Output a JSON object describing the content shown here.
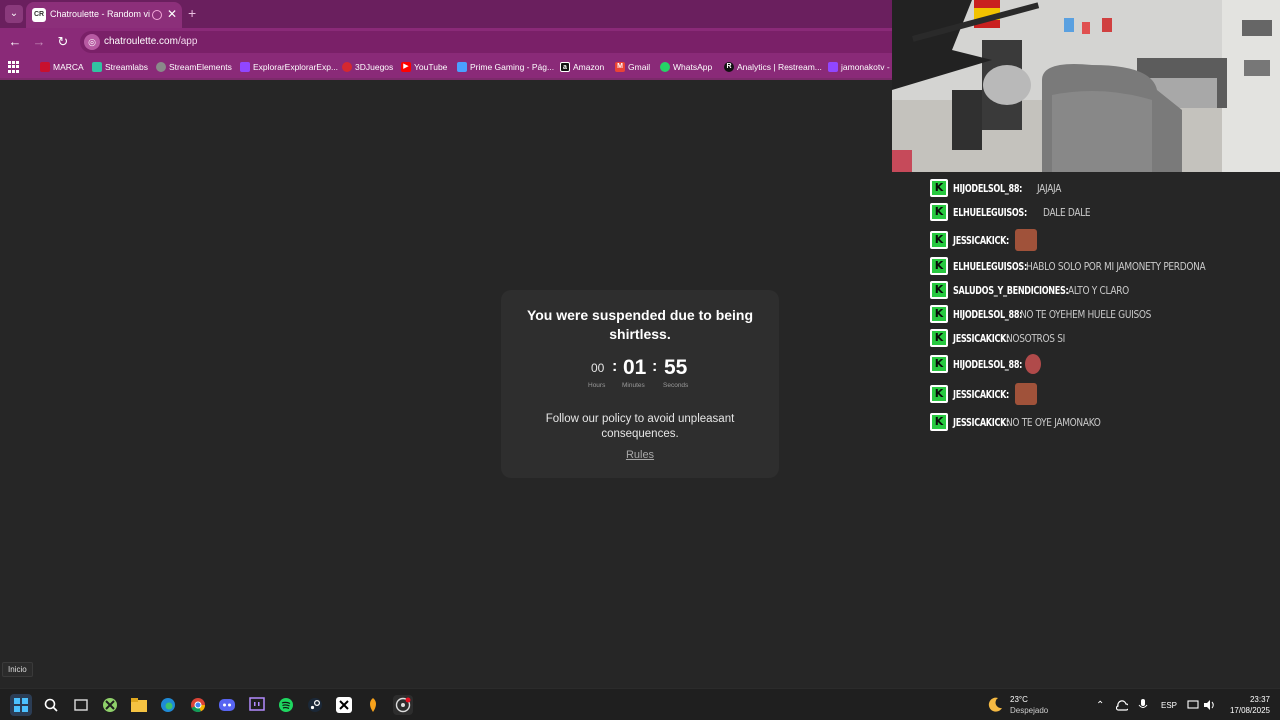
{
  "browser": {
    "tab_title": "Chatroulette - Random vid",
    "favicon": "CR",
    "url_host": "chatroulette.com",
    "url_path": "/app",
    "bookmarks": [
      {
        "label": "MARCA",
        "color": "#c8102e"
      },
      {
        "label": "Streamlabs",
        "color": "#31c3a2"
      },
      {
        "label": "StreamElements",
        "color": "#8a8a8a"
      },
      {
        "label": "ExplorarExplorarExp...",
        "color": "#9146ff"
      },
      {
        "label": "3DJuegos",
        "color": "#d6282f"
      },
      {
        "label": "YouTube",
        "color": "#ff0000"
      },
      {
        "label": "Prime Gaming - Pág...",
        "color": "#4aa0ff"
      },
      {
        "label": "Amazon",
        "color": "#111111"
      },
      {
        "label": "Gmail",
        "color": "#ea4335"
      },
      {
        "label": "WhatsApp",
        "color": "#25d366"
      },
      {
        "label": "Analytics | Restream...",
        "color": "#111111"
      },
      {
        "label": "jamonakotv - T",
        "color": "#9146ff"
      }
    ]
  },
  "suspension": {
    "heading": "You were suspended due to being shirtless.",
    "hours": "00",
    "minutes": "01",
    "seconds": "55",
    "sep": ":",
    "hours_label": "Hours",
    "minutes_label": "Minutes",
    "seconds_label": "Seconds",
    "policy": "Follow our policy to avoid unpleasant consequences.",
    "rules": "Rules"
  },
  "chat": {
    "badge": "K",
    "messages": [
      {
        "user": "HIJODELSOL_88:",
        "text": "JAJAJA",
        "emote": null
      },
      {
        "user": "ELHUELEGUISOS:",
        "text": "DALE DALE",
        "emote": null
      },
      {
        "user": "JESSICAKICK:",
        "text": "",
        "emote": "face-emote"
      },
      {
        "user": "ELHUELEGUISOS:",
        "text": "HABLO SOLO POR MI JAMONETY PERDONA",
        "emote": null
      },
      {
        "user": "SALUDOS_Y_BENDICIONES:",
        "text": "ALTO Y CLARO",
        "emote": null
      },
      {
        "user": "HIJODELSOL_88:",
        "text": "NO TE OYEHEM HUELE GUISOS",
        "emote": null
      },
      {
        "user": "JESSICAKICK:",
        "text": "NOSOTROS SI",
        "emote": null
      },
      {
        "user": "HIJODELSOL_88:",
        "text": "",
        "emote": "person-emote"
      },
      {
        "user": "JESSICAKICK:",
        "text": "",
        "emote": "face-emote"
      },
      {
        "user": "JESSICAKICK:",
        "text": "NO TE OYE JAMONAKO",
        "emote": null
      }
    ]
  },
  "taskbar": {
    "tooltip": "Inicio",
    "weather_temp": "23°C",
    "weather_desc": "Despejado",
    "language": "ESP",
    "time": "23:37",
    "date": "17/08/2025"
  }
}
